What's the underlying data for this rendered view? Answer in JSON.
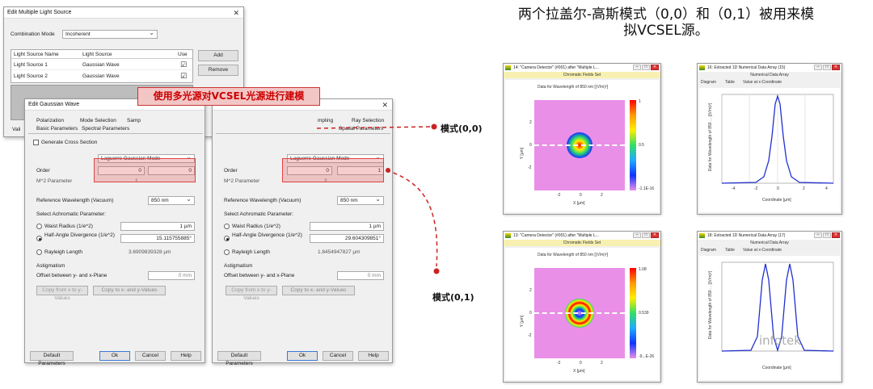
{
  "multi_dialog": {
    "title": "Edit Multiple Light Source",
    "combination_label": "Combination Mode",
    "combination_value": "Incoherent",
    "col_name": "Light Source Name",
    "col_type": "Light Source",
    "col_use": "Use",
    "rows": [
      {
        "name": "Light Source 1",
        "type": "Gaussian Wave",
        "use": "☑"
      },
      {
        "name": "Light Source 2",
        "type": "Gaussian Wave",
        "use": "☑"
      }
    ],
    "add_label": "Add",
    "remove_label": "Remove",
    "valid_label": "Vali"
  },
  "gauss_left": {
    "title": "Edit Gaussian Wave",
    "tabs_row1": [
      "Polarization",
      "Mode Selection",
      "Samp"
    ],
    "tabs_row2": [
      "Basic Parameters",
      "Spectral Parameters"
    ],
    "generate_cross": "Generate Cross Section",
    "mode_value": "Laguerre Gaussian Mode",
    "order_label": "Order",
    "order_values": [
      "0",
      "0"
    ],
    "m2_label": "M^2 Parameter",
    "m2_value": "1",
    "ref_wl_label": "Reference Wavelength (Vacuum)",
    "ref_wl_value": "850 nm",
    "achromatic_label": "Select Achromatic Parameter:",
    "waist_label": "Waist Radius (1/e^2)",
    "waist_value": "1 µm",
    "half_angle_label": "Half-Angle Divergence (1/e^2)",
    "half_angle_value": "15.115755885°",
    "rayleigh_label": "Rayleigh Length",
    "rayleigh_value": "3.6909839328 µm",
    "astig_label": "Astigmatism",
    "offset_label": "Offset between y- and x-Plane",
    "offset_value": "0 mm",
    "btn_left": "Copy from x to y-Values",
    "btn_right": "Copy to x- and y-Values",
    "default_btn": "Default Parameters",
    "ok": "Ok",
    "cancel": "Cancel",
    "help": "Help"
  },
  "gauss_right": {
    "tabs_row1": [
      "mpling",
      "Ray Selection"
    ],
    "tabs_row2": [
      "Spatial Parameters"
    ],
    "mode_value": "Laguerre Gaussian Mode",
    "order_label": "Order",
    "order_values": [
      "0",
      "1"
    ],
    "m2_label": "M^2 Parameter",
    "m2_value": "2",
    "ref_wl_label": "Reference Wavelength (Vacuum)",
    "ref_wl_value": "850 nm",
    "achromatic_label": "Select Achromatic Parameter:",
    "waist_label": "Waist Radius (1/e^2)",
    "waist_value": "1 µm",
    "half_angle_label": "Half-Angle Divergence (1/e^2)",
    "half_angle_value": "29.604309851°",
    "rayleigh_label": "Rayleigh Length",
    "rayleigh_value": "1.8454947827 µm",
    "astig_label": "Astigmatism",
    "offset_label": "Offset between y- and x-Plane",
    "offset_value": "0 mm",
    "btn_left": "Copy from x to y-Values",
    "btn_right": "Copy to x- and y-Values",
    "default_btn": "Default Parameters",
    "ok": "Ok",
    "cancel": "Cancel",
    "help": "Help"
  },
  "callout": {
    "text": "使用多光源对VCSEL光源进行建模"
  },
  "headline": {
    "line1": "两个拉盖尔-高斯模式（0,0）和（0,1）被用来模",
    "line2": "拟VCSEL源。"
  },
  "mode_labels": {
    "m00": "模式(0,0)",
    "m01": "模式(0,1)"
  },
  "detector_top": {
    "title": "14: \"Camera Detector\" (#001) after \"Multiple L...",
    "subtitle": "Chromatic Fields Set",
    "plot_title": "Data for Wavelength of 850 nm  [(V/m)²]",
    "ylabel": "Y [µm]",
    "xlabel": "X [µm]",
    "xticks": [
      "-2",
      "0",
      "2"
    ],
    "yticks": [
      "2",
      "0",
      "-2"
    ],
    "cbar_ticks": [
      "1",
      "0.5",
      "-1.1E-16"
    ]
  },
  "detector_bottom": {
    "title": "13: \"Camera Detector\" (#001) after \"Multiple L...",
    "subtitle": "Chromatic Fields Set",
    "plot_title": "Data for Wavelength of 850 nm  [(V/m)²]",
    "ylabel": "Y [µm]",
    "xlabel": "X [µm]",
    "xticks": [
      "-2",
      "0",
      "2"
    ],
    "yticks": [
      "2",
      "0",
      "-2"
    ],
    "cbar_ticks": [
      "1.08",
      "0.539",
      "-9...E-26"
    ]
  },
  "line_top": {
    "title": "16: Extracted 1D Numerical Data Array (15)",
    "subtitle": "Numerical Data Array",
    "tabs": [
      "Diagram",
      "Table",
      "Value at x-Coordinate"
    ],
    "ylabel": "Data for Wavelength of 850 ... [(V/m)²]",
    "xlabel": "Coordinate [µm]",
    "xticks": [
      "-4",
      "-2",
      "0",
      "2",
      "4"
    ]
  },
  "line_bottom": {
    "title": "18: Extracted 1D Numerical Data Array (17)",
    "subtitle": "Numerical Data Array",
    "tabs": [
      "Diagram",
      "Table",
      "Value at x-Coordinate"
    ],
    "ylabel": "Data for Wavelength of 850 ... [(V/m)²]",
    "xlabel": "Coordinate [µm]",
    "watermark": "infotek"
  },
  "colors": {
    "accent_red": "#cc2222",
    "plot_bg": "#e98fe8",
    "curve": "#2030d0"
  }
}
